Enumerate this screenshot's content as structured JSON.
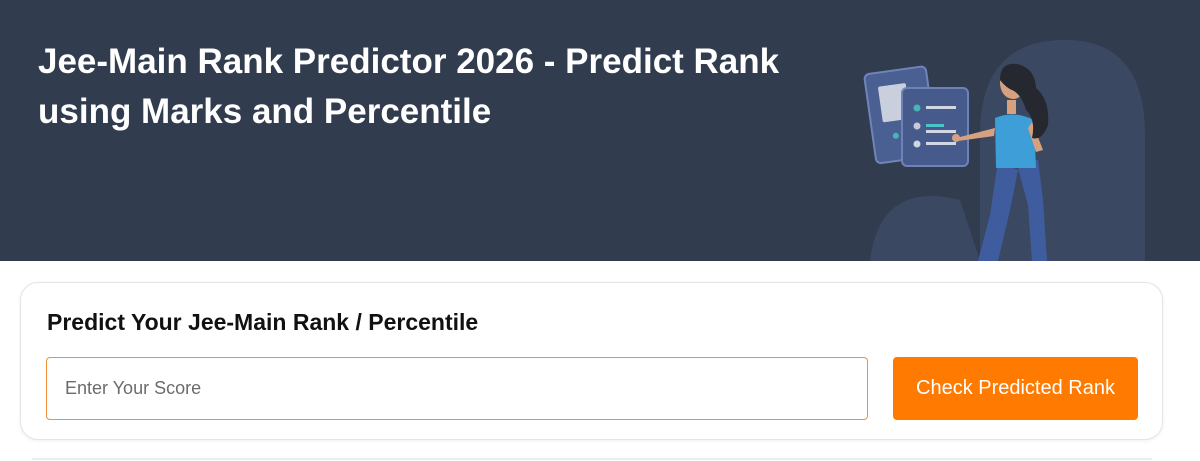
{
  "hero": {
    "title": "Jee-Main Rank Predictor 2026 - Predict Rank using Marks and Percentile",
    "background_color": "#323c4f",
    "illustration_icon": "person-with-documents-illustration"
  },
  "predictor": {
    "title": "Predict Your Jee-Main Rank / Percentile",
    "score_placeholder": "Enter Your Score",
    "score_value": "",
    "submit_label": "Check Predicted Rank",
    "accent_color": "#ff7a00"
  }
}
